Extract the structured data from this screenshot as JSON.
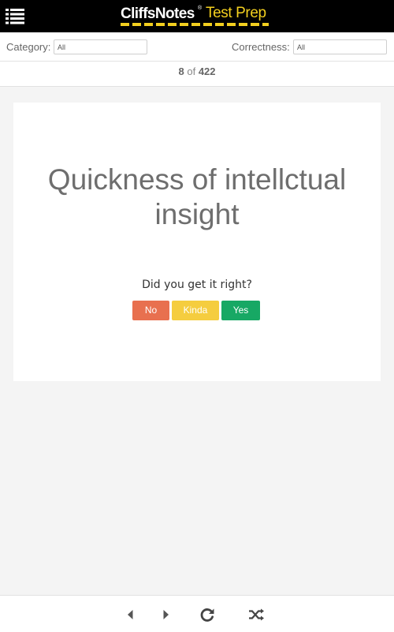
{
  "header": {
    "brand": "CliffsNotes",
    "registered_mark": "®",
    "product": "Test Prep",
    "menu_icon": "menu-list-icon",
    "brand_color": "#f3cf1f"
  },
  "filters": {
    "category_label": "Category:",
    "category_value": "All",
    "correctness_label": "Correctness:",
    "correctness_value": "All"
  },
  "counter": {
    "current": "8",
    "separator": "of",
    "total": "422"
  },
  "card": {
    "term": "Quickness of intellctual insight",
    "question": "Did you get it right?",
    "buttons": {
      "no": "No",
      "kinda": "Kinda",
      "yes": "Yes"
    },
    "button_colors": {
      "no": "#e8704f",
      "kinda": "#f5cd3f",
      "yes": "#17a864"
    }
  },
  "toolbar": {
    "icons": [
      "previous-icon",
      "next-icon",
      "restart-icon",
      "shuffle-icon"
    ]
  }
}
